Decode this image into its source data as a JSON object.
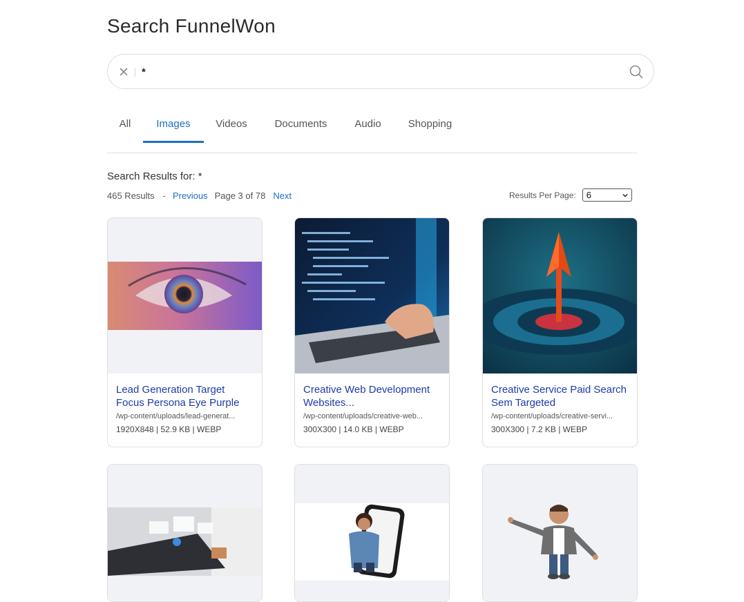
{
  "page": {
    "title": "Search FunnelWon"
  },
  "search": {
    "query": "*",
    "clear_icon": "close-icon",
    "search_icon": "search-icon"
  },
  "tabs": [
    {
      "label": "All",
      "active": false
    },
    {
      "label": "Images",
      "active": true
    },
    {
      "label": "Videos",
      "active": false
    },
    {
      "label": "Documents",
      "active": false
    },
    {
      "label": "Audio",
      "active": false
    },
    {
      "label": "Shopping",
      "active": false
    }
  ],
  "results": {
    "label": "Search Results for: *",
    "count": "465 Results",
    "separator": "-",
    "previous": "Previous",
    "page_indicator": "Page 3 of 78",
    "next": "Next",
    "per_page_label": "Results Per Page:",
    "per_page_value": "6"
  },
  "colors": {
    "accent": "#1c6fc2",
    "card_title": "#1f3aa8"
  },
  "cards": [
    {
      "title": "Lead Generation Target Focus Persona Eye Purple",
      "path": "/wp-content/uploads/lead-generat...",
      "info": "1920X848 | 52.9 KB | WEBP"
    },
    {
      "title": "Creative Web Development Websites...",
      "path": "/wp-content/uploads/creative-web...",
      "info": "300X300 | 14.0 KB | WEBP"
    },
    {
      "title": "Creative Service Paid Search Sem Targeted",
      "path": "/wp-content/uploads/creative-servi...",
      "info": "300X300 | 7.2 KB | WEBP"
    },
    {
      "title": "",
      "path": "",
      "info": ""
    },
    {
      "title": "",
      "path": "",
      "info": ""
    },
    {
      "title": "",
      "path": "",
      "info": ""
    }
  ]
}
